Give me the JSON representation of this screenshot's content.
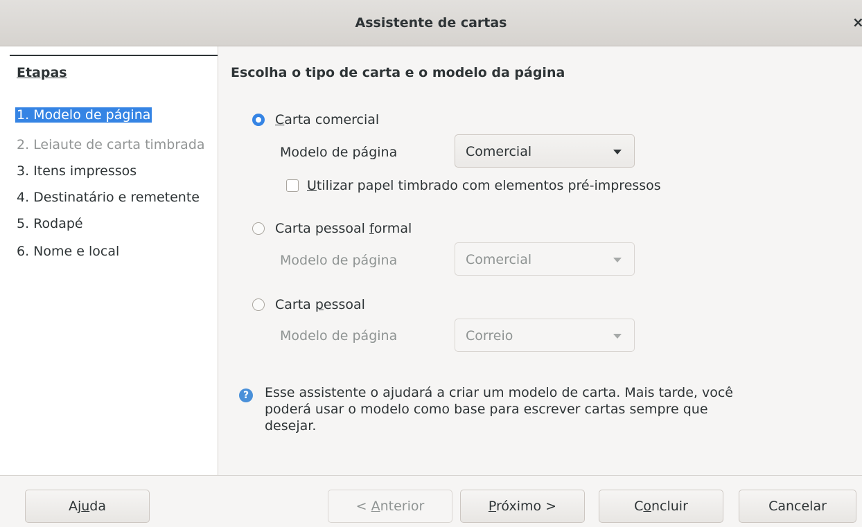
{
  "window": {
    "title": "Assistente de cartas",
    "close_glyph": "×"
  },
  "sidebar": {
    "title": "Etapas",
    "steps": [
      {
        "label": "1. Modelo de página",
        "state": "active"
      },
      {
        "label": "2. Leiaute de carta timbrada",
        "state": "disabled"
      },
      {
        "label": "3. Itens impressos",
        "state": "normal"
      },
      {
        "label": "4. Destinatário e remetente",
        "state": "normal"
      },
      {
        "label": "5. Rodapé",
        "state": "normal"
      },
      {
        "label": "6. Nome e local",
        "state": "normal"
      }
    ]
  },
  "main": {
    "heading": "Escolha o tipo de carta e o modelo da página",
    "options": [
      {
        "label_pre": "",
        "label_mn": "C",
        "label_post": "arta comercial",
        "selected": true,
        "template_label": "Modelo de página",
        "template_value": "Comercial",
        "enabled": true
      },
      {
        "label_pre": "Carta pessoal ",
        "label_mn": "f",
        "label_post": "ormal",
        "selected": false,
        "template_label": "Modelo de página",
        "template_value": "Comercial",
        "enabled": false
      },
      {
        "label_pre": "Carta ",
        "label_mn": "p",
        "label_post": "essoal",
        "selected": false,
        "template_label": "Modelo de página",
        "template_value": "Correio",
        "enabled": false
      }
    ],
    "letterhead_checkbox": {
      "label_mn": "U",
      "label_post": "tilizar papel timbrado com elementos pré-impressos",
      "checked": false
    },
    "info_icon": "help-icon",
    "info_text": "Esse assistente o ajudará a criar um modelo de carta. Mais tarde, você poderá usar o modelo como base para escrever cartas sempre que desejar."
  },
  "buttons": {
    "help": {
      "pre": "Aj",
      "mn": "u",
      "post": "da"
    },
    "previous": {
      "pre": "< ",
      "mn": "A",
      "post": "nterior"
    },
    "next": {
      "pre": "",
      "mn": "P",
      "post": "róximo >"
    },
    "finish": {
      "pre": "C",
      "mn": "o",
      "post": "ncluir"
    },
    "cancel": {
      "pre": "Cancelar",
      "mn": "",
      "post": ""
    }
  },
  "colors": {
    "accent": "#3584e4",
    "info": "#4a90d9"
  }
}
